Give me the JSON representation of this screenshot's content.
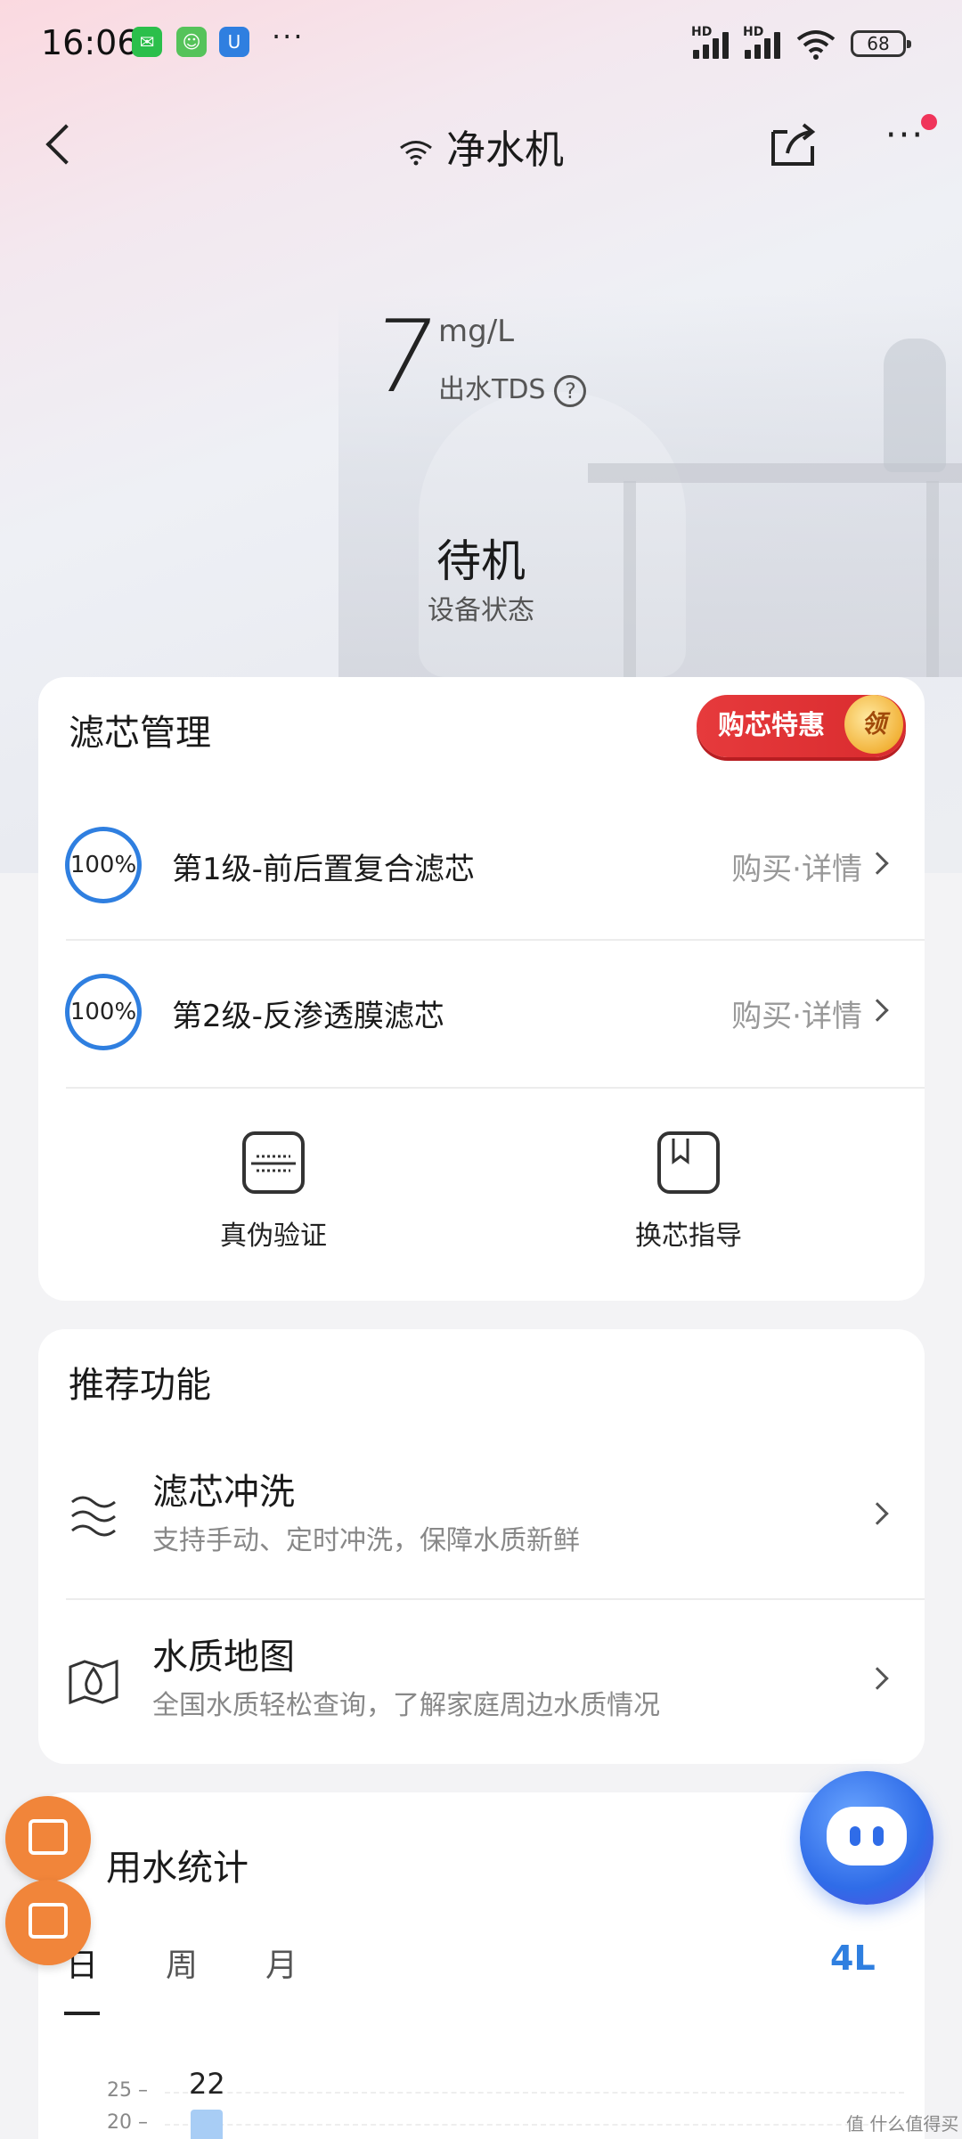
{
  "status_bar": {
    "time": "16:06",
    "battery": "68",
    "network_1": "HD",
    "network_2": "HD",
    "overflow": "···"
  },
  "nav": {
    "title": "净水机",
    "more": "···"
  },
  "device": {
    "tds_value": "7",
    "tds_unit": "mg/L",
    "tds_label": "出水TDS",
    "state": "待机",
    "state_label": "设备状态"
  },
  "filter_card": {
    "title": "滤芯管理",
    "promo_label": "购芯特惠",
    "promo_coin": "领",
    "filters": [
      {
        "percent": "100%",
        "name": "第1级-前后置复合滤芯",
        "link": "购买·详情",
        "level": 1.0
      },
      {
        "percent": "100%",
        "name": "第2级-反渗透膜滤芯",
        "link": "购买·详情",
        "level": 1.0
      }
    ],
    "tools": [
      {
        "label": "真伪验证",
        "icon": "scan-icon"
      },
      {
        "label": "换芯指导",
        "icon": "book-icon"
      }
    ]
  },
  "recommend": {
    "title": "推荐功能",
    "items": [
      {
        "title": "滤芯冲洗",
        "subtitle": "支持手动、定时冲洗，保障水质新鲜",
        "icon": "waves-icon"
      },
      {
        "title": "水质地图",
        "subtitle": "全国水质轻松查询，了解家庭周边水质情况",
        "icon": "map-drop-icon"
      }
    ]
  },
  "stats": {
    "title": "用水统计",
    "tabs": [
      "日",
      "周",
      "月"
    ],
    "selected_tab": "日",
    "total": "4L",
    "y_ticks": [
      "25 –",
      "20 –"
    ],
    "bar_label": "22"
  },
  "colors": {
    "accent": "#2f7fe0",
    "promo": "#e63a3c",
    "float": "#f1853a"
  },
  "watermark": "值 什么值得买"
}
